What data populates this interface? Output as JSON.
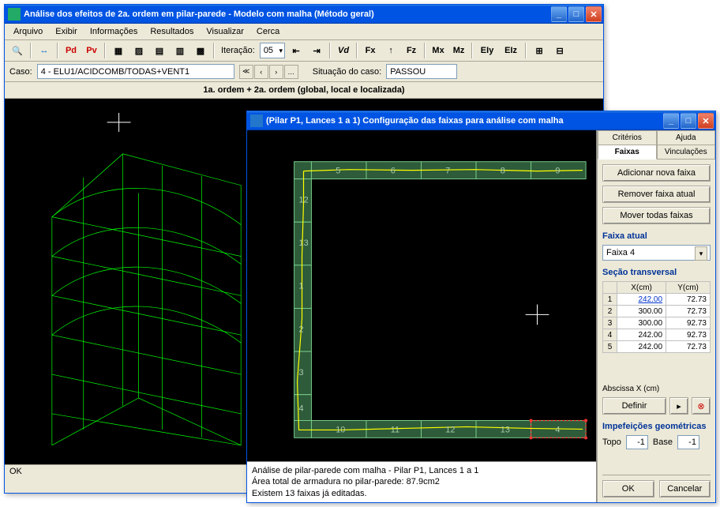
{
  "win1": {
    "title": "Análise dos efeitos de 2a. ordem em pilar-parede - Modelo com malha (Método geral)",
    "menus": [
      "Arquivo",
      "Exibir",
      "Informações",
      "Resultados",
      "Visualizar",
      "Cerca"
    ],
    "iter_label": "Iteração:",
    "iter_value": "05",
    "caso_label": "Caso:",
    "caso_value": "4 - ELU1/ACIDCOMB/TODAS+VENT1",
    "situ_label": "Situação do caso:",
    "situ_value": "PASSOU",
    "heading": "1a. ordem + 2a. ordem (global, local e localizada)",
    "status": "OK",
    "tb": {
      "pd": "Pd",
      "pv": "Pv",
      "vd": "Vd",
      "fx": "Fx",
      "fz": "Fz",
      "mx": "Mx",
      "mz": "Mz",
      "eiy": "EIy",
      "eiz": "EIz"
    }
  },
  "win2": {
    "title": "(Pilar P1, Lances 1 a 1) Configuração das faixas para análise com malha",
    "tabs_top": [
      "Critérios",
      "Ajuda"
    ],
    "tabs_bot": [
      "Faixas",
      "Vinculações"
    ],
    "active_tab": "Faixas",
    "btn_add": "Adicionar nova faixa",
    "btn_remove": "Remover faixa atual",
    "btn_move": "Mover todas faixas",
    "faixa_label": "Faixa atual",
    "faixa_value": "Faixa 4",
    "secao_label": "Seção transversal",
    "cols": {
      "x": "X(cm)",
      "y": "Y(cm)"
    },
    "coords": [
      {
        "n": "1",
        "x": "242.00",
        "y": "72.73"
      },
      {
        "n": "2",
        "x": "300.00",
        "y": "72.73"
      },
      {
        "n": "3",
        "x": "300.00",
        "y": "92.73"
      },
      {
        "n": "4",
        "x": "242.00",
        "y": "92.73"
      },
      {
        "n": "5",
        "x": "242.00",
        "y": "72.73"
      }
    ],
    "abscissa": "Abscissa X (cm)",
    "definir": "Definir",
    "imperf_label": "Impefeições geométricas",
    "topo_label": "Topo",
    "topo_value": "-1",
    "base_label": "Base",
    "base_value": "-1",
    "ok": "OK",
    "cancel": "Cancelar",
    "info1": "Análise de pilar-parede com malha - Pilar P1, Lances 1 a 1",
    "info2": "Área total de armadura no pilar-parede: 87.9cm2",
    "info3": "Existem 13 faixas já editadas.",
    "plan_labels": [
      "1",
      "2",
      "3",
      "4",
      "5",
      "6",
      "7",
      "8",
      "9",
      "10",
      "11",
      "12",
      "13"
    ]
  }
}
